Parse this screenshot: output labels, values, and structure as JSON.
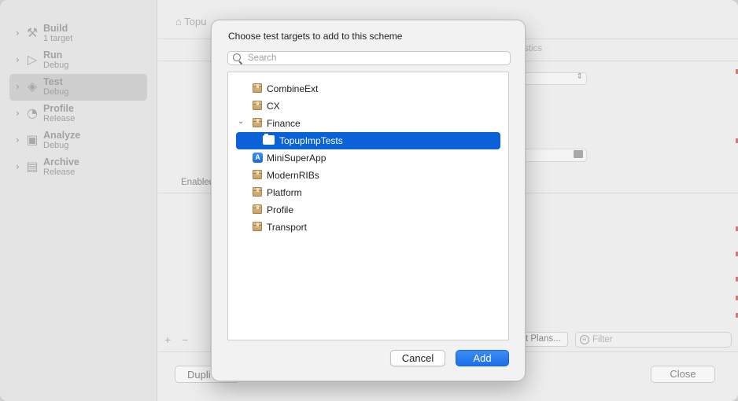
{
  "background": {
    "sidebar": {
      "actions": [
        {
          "name": "Build",
          "sub": "1 target",
          "icon": "hammer-icon",
          "glyph": "⚒"
        },
        {
          "name": "Run",
          "sub": "Debug",
          "icon": "play-icon",
          "glyph": "▷"
        },
        {
          "name": "Test",
          "sub": "Debug",
          "icon": "test-diamond-icon",
          "glyph": "◈"
        },
        {
          "name": "Profile",
          "sub": "Release",
          "icon": "gauge-icon",
          "glyph": "◔"
        },
        {
          "name": "Analyze",
          "sub": "Debug",
          "icon": "analyze-icon",
          "glyph": "▣"
        },
        {
          "name": "Archive",
          "sub": "Release",
          "icon": "archive-icon",
          "glyph": "▤"
        }
      ],
      "selected_index": 2
    },
    "breadcrumb": "Topu",
    "tab_fragment": "stics",
    "enabled_label": "Enabled",
    "test_plans_button": "t Plans...",
    "filter_placeholder": "Filter",
    "duplicate_button": "Dupli",
    "close_button": "Close",
    "plus_label": "+",
    "minus_label": "−"
  },
  "dialog": {
    "title": "Choose test targets to add to this scheme",
    "search": {
      "placeholder": "Search",
      "value": ""
    },
    "targets": [
      {
        "label": "CombineExt",
        "type": "package",
        "level": 0
      },
      {
        "label": "CX",
        "type": "package",
        "level": 0
      },
      {
        "label": "Finance",
        "type": "package",
        "level": 0,
        "expanded": true
      },
      {
        "label": "TopupImpTests",
        "type": "test-bundle",
        "level": 1,
        "selected": true
      },
      {
        "label": "MiniSuperApp",
        "type": "app",
        "level": 0
      },
      {
        "label": "ModernRIBs",
        "type": "package",
        "level": 0
      },
      {
        "label": "Platform",
        "type": "package",
        "level": 0
      },
      {
        "label": "Profile",
        "type": "package",
        "level": 0
      },
      {
        "label": "Transport",
        "type": "package",
        "level": 0
      }
    ],
    "cancel_label": "Cancel",
    "add_label": "Add"
  }
}
